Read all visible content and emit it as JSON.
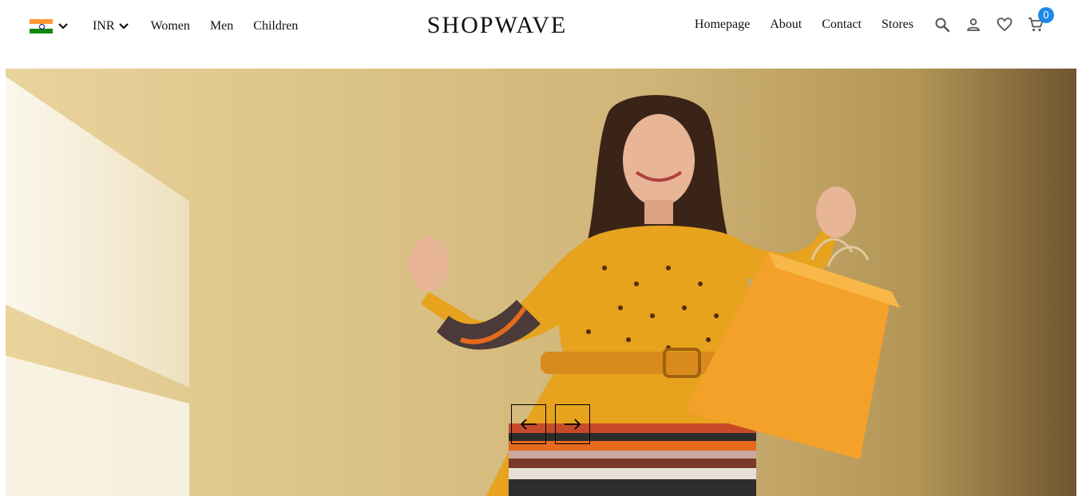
{
  "header": {
    "country_flag": "india-flag-icon",
    "currency": "INR",
    "categories": [
      "Women",
      "Men",
      "Children"
    ],
    "brand": "SHOPWAVE",
    "nav": [
      "Homepage",
      "About",
      "Contact",
      "Stores"
    ],
    "icons": [
      "search-icon",
      "user-icon",
      "heart-icon",
      "cart-icon"
    ],
    "cart_count": "0",
    "badge_color": "#1e88e5"
  },
  "hero": {
    "image_subject": "woman-with-shopping-bag",
    "prev_icon": "arrow-left-icon",
    "next_icon": "arrow-right-icon"
  }
}
